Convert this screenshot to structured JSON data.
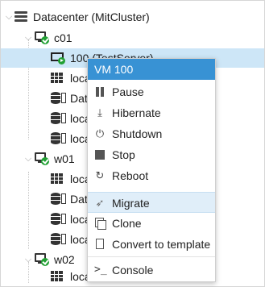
{
  "tree": {
    "datacenter": "Datacenter (MitCluster)",
    "nodes": [
      {
        "name": "c01"
      },
      {
        "name": "w01"
      },
      {
        "name": "w02"
      }
    ],
    "c01_children": {
      "vm": "100 (TestServer)",
      "storage_local": "local",
      "storage_data": "Data",
      "storage_local2": "local-lvm",
      "storage_local3": "local-zfs"
    },
    "w01_children": {
      "storage_local": "local",
      "storage_data": "Data",
      "storage_local2": "local-lvm",
      "storage_local3": "local-zfs"
    },
    "w02_children": {
      "storage_local": "local"
    }
  },
  "menu": {
    "title": "VM 100",
    "items": [
      {
        "label": "Pause",
        "icon": "pause-icon"
      },
      {
        "label": "Hibernate",
        "icon": "hibernate-icon"
      },
      {
        "label": "Shutdown",
        "icon": "power-icon"
      },
      {
        "label": "Stop",
        "icon": "stop-icon"
      },
      {
        "label": "Reboot",
        "icon": "reboot-icon"
      },
      {
        "label": "Migrate",
        "icon": "send-icon",
        "highlighted": true
      },
      {
        "label": "Clone",
        "icon": "clone-icon"
      },
      {
        "label": "Convert to template",
        "icon": "file-icon"
      },
      {
        "label": "Console",
        "icon": "terminal-icon"
      }
    ]
  },
  "colors": {
    "selection": "#cde6f7",
    "menu_header": "#3892d4",
    "menu_highlight": "#e0eef9",
    "status_ok": "#21a033"
  }
}
